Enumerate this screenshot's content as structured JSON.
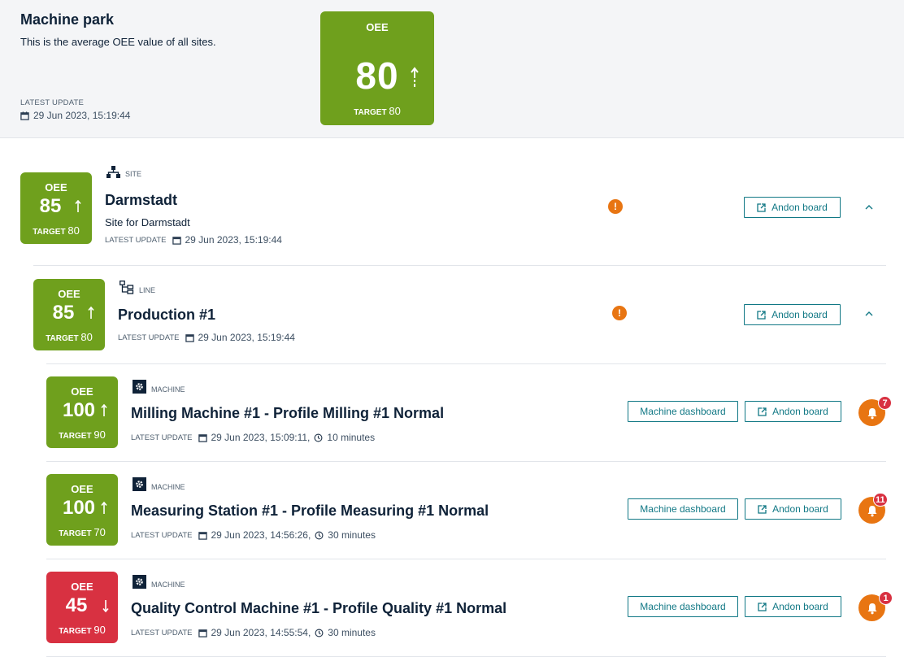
{
  "header": {
    "title": "Machine park",
    "description": "This is the average OEE value of all sites.",
    "latest_update_label": "LATEST UPDATE",
    "latest_update": "29 Jun 2023, 15:19:44",
    "oee": {
      "label": "OEE",
      "value": "80",
      "trend": "up",
      "target_label": "TARGET",
      "target": "80",
      "status": "good"
    }
  },
  "colors": {
    "good": "#6fa01d",
    "bad": "#d83141",
    "accent": "#117885",
    "warning": "#e87512"
  },
  "site": {
    "type": "SITE",
    "type_icon": "hierarchy-icon",
    "name": "Darmstadt",
    "description": "Site for Darmstadt",
    "latest_update_label": "LATEST UPDATE",
    "latest_update": "29 Jun 2023, 15:19:44",
    "oee": {
      "label": "OEE",
      "value": "85",
      "trend": "up",
      "target_label": "TARGET",
      "target": "80",
      "status": "good"
    },
    "andon_label": "Andon board",
    "has_warning": true,
    "warning_glyph": "!"
  },
  "line": {
    "type": "LINE",
    "type_icon": "tree-icon",
    "name": "Production #1",
    "latest_update_label": "LATEST UPDATE",
    "latest_update": "29 Jun 2023, 15:19:44",
    "oee": {
      "label": "OEE",
      "value": "85",
      "trend": "up",
      "target_label": "TARGET",
      "target": "80",
      "status": "good"
    },
    "andon_label": "Andon board",
    "has_warning": true,
    "warning_glyph": "!"
  },
  "machines": [
    {
      "type": "MACHINE",
      "name": "Milling Machine #1 - Profile Milling #1 Normal",
      "latest_update_label": "LATEST UPDATE",
      "latest_update": "29 Jun 2023, 15:09:11,",
      "interval": "10 minutes",
      "oee": {
        "label": "OEE",
        "value": "100",
        "trend": "up",
        "target_label": "TARGET",
        "target": "90",
        "status": "good"
      },
      "dashboard_label": "Machine dashboard",
      "andon_label": "Andon board",
      "alarms": "7"
    },
    {
      "type": "MACHINE",
      "name": "Measuring Station #1 - Profile Measuring #1 Normal",
      "latest_update_label": "LATEST UPDATE",
      "latest_update": "29 Jun 2023, 14:56:26,",
      "interval": "30 minutes",
      "oee": {
        "label": "OEE",
        "value": "100",
        "trend": "up",
        "target_label": "TARGET",
        "target": "70",
        "status": "good"
      },
      "dashboard_label": "Machine dashboard",
      "andon_label": "Andon board",
      "alarms": "11"
    },
    {
      "type": "MACHINE",
      "name": "Quality Control Machine #1 - Profile Quality #1 Normal",
      "latest_update_label": "LATEST UPDATE",
      "latest_update": "29 Jun 2023, 14:55:54,",
      "interval": "30 minutes",
      "oee": {
        "label": "OEE",
        "value": "45",
        "trend": "down",
        "target_label": "TARGET",
        "target": "90",
        "status": "bad"
      },
      "dashboard_label": "Machine dashboard",
      "andon_label": "Andon board",
      "alarms": "1"
    }
  ]
}
